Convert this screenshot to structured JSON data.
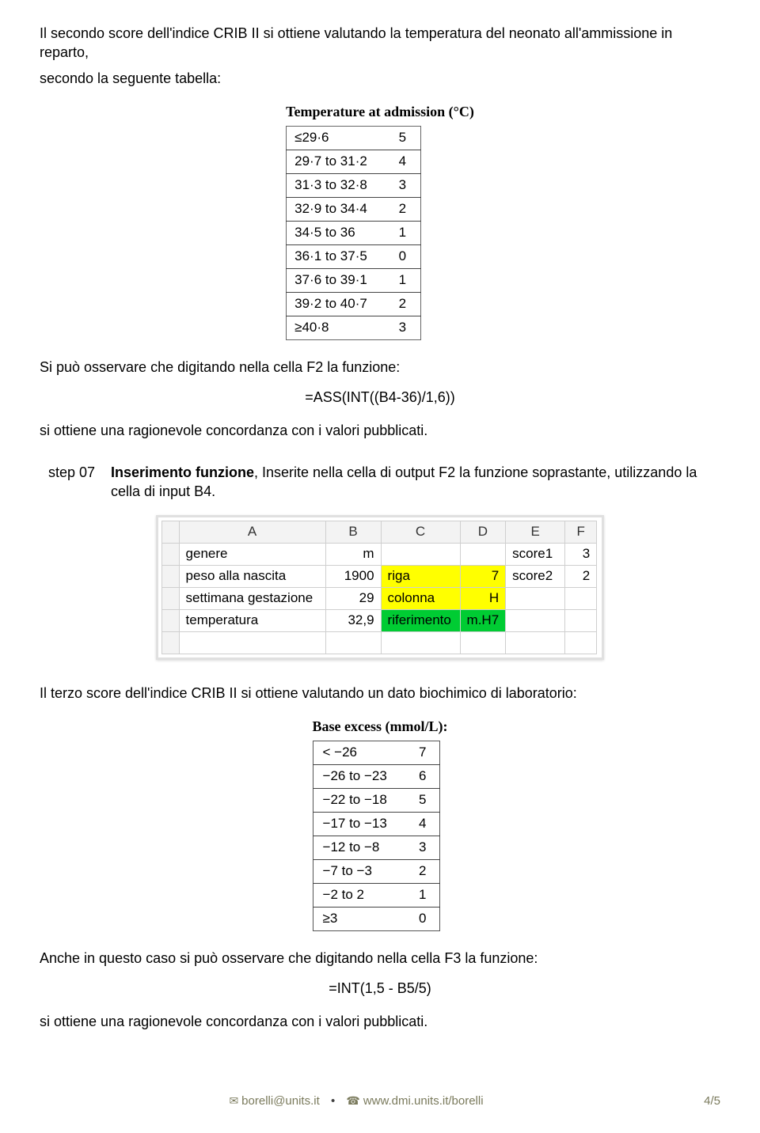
{
  "intro1a": "Il secondo score dell'indice CRIB II si ottiene valutando la temperatura del neonato all'ammissione in reparto,",
  "intro1b": "secondo la seguente tabella:",
  "temp_table": {
    "title": "Temperature at admission (°C)",
    "rows": [
      {
        "range": "≤29·6",
        "score": "5"
      },
      {
        "range": "29·7 to 31·2",
        "score": "4"
      },
      {
        "range": "31·3 to 32·8",
        "score": "3"
      },
      {
        "range": "32·9 to 34·4",
        "score": "2"
      },
      {
        "range": "34·5 to 36",
        "score": "1"
      },
      {
        "range": "36·1 to 37·5",
        "score": "0"
      },
      {
        "range": "37·6 to 39·1",
        "score": "1"
      },
      {
        "range": "39·2 to 40·7",
        "score": "2"
      },
      {
        "range": "≥40·8",
        "score": "3"
      }
    ]
  },
  "observe1": "Si può osservare che digitando nella cella F2 la funzione:",
  "formula1": "=ASS(INT((B4-36)/1,6))",
  "conc1": "si ottiene una ragionevole concordanza con i valori pubblicati.",
  "step": {
    "label": "step 07",
    "title": "Inserimento funzione",
    "rest": ", Inserite nella cella di output F2 la funzione soprastante, utilizzando la cella di input B4."
  },
  "spreadsheet": {
    "headers": [
      "",
      "A",
      "B",
      "C",
      "D",
      "E",
      "F"
    ],
    "rows": [
      {
        "A": "genere",
        "B": "m",
        "C": "",
        "D": "",
        "E": "score1",
        "F": "3",
        "c_hl": "",
        "d_hl": "",
        "e_red": true
      },
      {
        "A": "peso alla nascita",
        "B": "1900",
        "C": "riga",
        "D": "7",
        "E": "score2",
        "F": "2",
        "c_hl": "y",
        "d_hl": "y",
        "e_red": true
      },
      {
        "A": "settimana gestazione",
        "B": "29",
        "C": "colonna",
        "D": "H",
        "E": "",
        "F": "",
        "c_hl": "y",
        "d_hl": "y",
        "e_red": false
      },
      {
        "A": "temperatura",
        "B": "32,9",
        "C": "riferimento",
        "D": "m.H7",
        "E": "",
        "F": "",
        "c_hl": "g",
        "d_hl": "g",
        "e_red": false
      }
    ]
  },
  "intro3": "Il terzo score dell'indice CRIB II si ottiene valutando un dato biochimico di laboratorio:",
  "be_table": {
    "title": "Base excess (mmol/L):",
    "rows": [
      {
        "range": "< −26",
        "score": "7"
      },
      {
        "range": "−26 to −23",
        "score": "6"
      },
      {
        "range": "−22 to −18",
        "score": "5"
      },
      {
        "range": "−17 to −13",
        "score": "4"
      },
      {
        "range": "−12 to −8",
        "score": "3"
      },
      {
        "range": "−7 to −3",
        "score": "2"
      },
      {
        "range": "−2 to 2",
        "score": "1"
      },
      {
        "range": "≥3",
        "score": "0"
      }
    ]
  },
  "observe2": "Anche in questo caso si può osservare che digitando nella cella F3 la funzione:",
  "formula2": "=INT(1,5 - B5/5)",
  "conc2": "si ottiene una ragionevole concordanza con i valori pubblicati.",
  "footer": {
    "email": "borelli@units.it",
    "url": "www.dmi.units.it/borelli",
    "page": "4/5"
  }
}
